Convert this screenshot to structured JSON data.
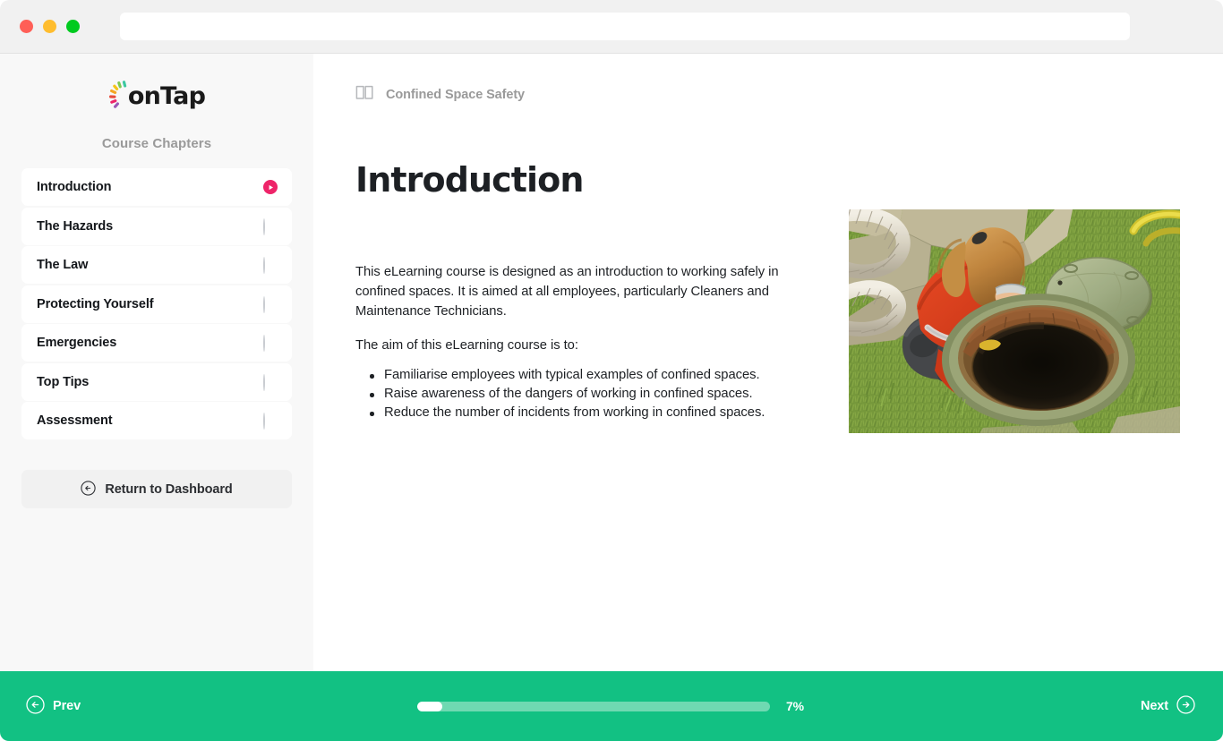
{
  "window": {
    "traffic_lights": [
      {
        "name": "close-button",
        "color": "#ff5f57"
      },
      {
        "name": "minimize-button",
        "color": "#ffbd2e"
      },
      {
        "name": "maximize-button",
        "color": "#00ca1f"
      }
    ],
    "url_value": "",
    "url_placeholder": ""
  },
  "sidebar": {
    "logo_text": "onTap",
    "logo_burst_colors": [
      "#7ec850",
      "#3cc8a0",
      "#f5a623",
      "#ee2469",
      "#f5c518",
      "#9b59b6",
      "#e74c3c",
      "#2ecc71"
    ],
    "section_label": "Course Chapters",
    "chapters": [
      {
        "label": "Introduction",
        "status": "play",
        "active": true
      },
      {
        "label": "The Hazards",
        "status": "circle",
        "active": false
      },
      {
        "label": "The Law",
        "status": "circle",
        "active": false
      },
      {
        "label": "Protecting Yourself",
        "status": "circle",
        "active": false
      },
      {
        "label": "Emergencies",
        "status": "circle",
        "active": false
      },
      {
        "label": "Top Tips",
        "status": "circle",
        "active": false
      },
      {
        "label": "Assessment",
        "status": "circle",
        "active": false
      }
    ],
    "return_button_label": "Return to Dashboard"
  },
  "main": {
    "breadcrumb": "Confined Space Safety",
    "title": "Introduction",
    "intro_paragraph": "This eLearning course is designed as an introduction to working safely in confined spaces. It is aimed at all employees, particularly Cleaners and Maintenance Technicians.",
    "aim_paragraph": "The aim of this eLearning course is to:",
    "aims": [
      "Familiarise employees with typical examples of confined spaces.",
      "Raise awareness of the dangers of working in confined spaces.",
      "Reduce the number of incidents from working in confined spaces."
    ],
    "image_alt": "Worker in red coveralls kneeling beside an open manhole in grass"
  },
  "footer": {
    "prev_label": "Prev",
    "next_label": "Next",
    "progress_percent_label": "7%",
    "progress_value": 7,
    "background_color": "#12c183",
    "track_color": "#6fd9b2",
    "fill_color": "#ffffff"
  },
  "accent": {
    "brand_pink": "#ee2469",
    "footer_green": "#12c183",
    "sidebar_bg": "#f8f8f8"
  }
}
